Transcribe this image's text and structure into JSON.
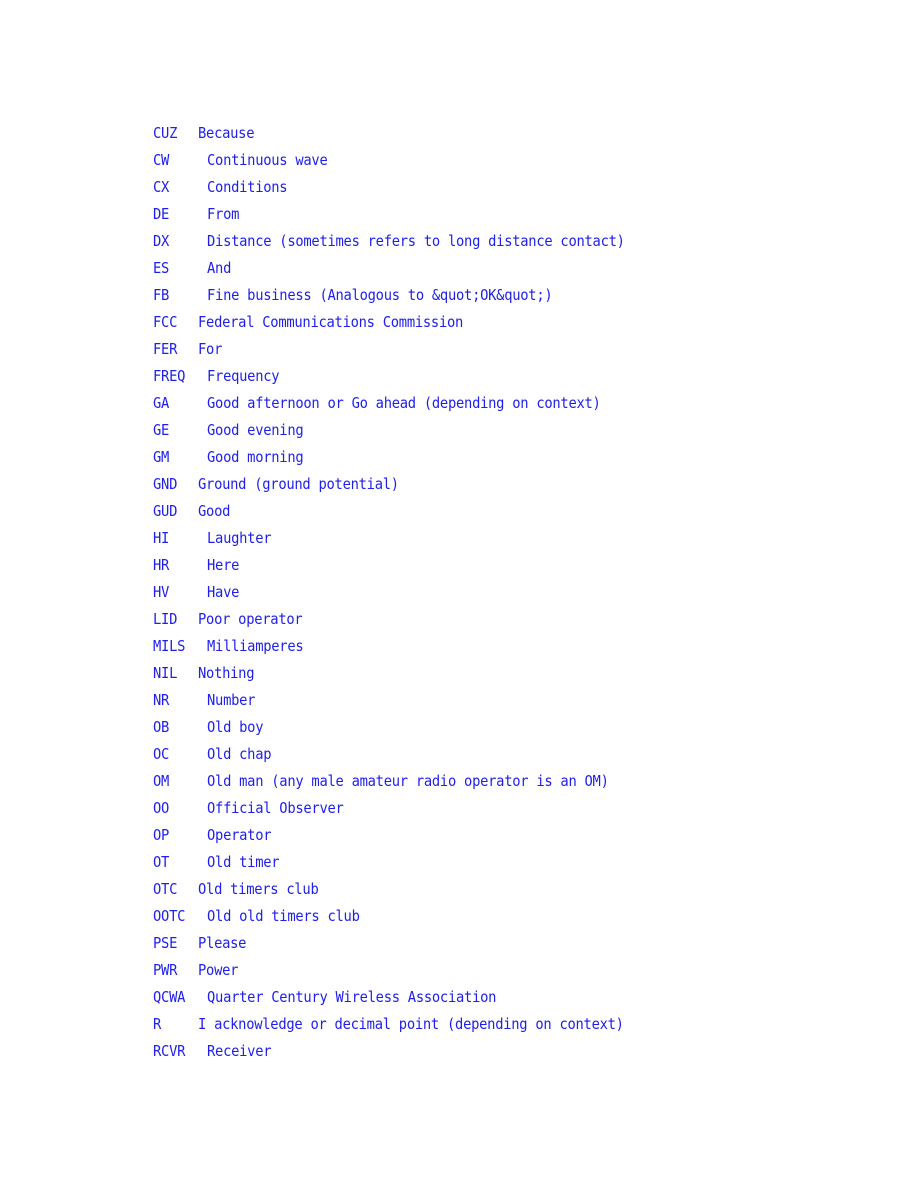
{
  "document": {
    "text_color": "#1e1ef0",
    "entries": [
      {
        "abbr": "CUZ",
        "definition": "Because",
        "indent": "short"
      },
      {
        "abbr": "CW",
        "definition": "Continuous wave",
        "indent": "long"
      },
      {
        "abbr": "CX",
        "definition": "Conditions",
        "indent": "long"
      },
      {
        "abbr": "DE",
        "definition": "From",
        "indent": "long"
      },
      {
        "abbr": "DX",
        "definition": "Distance (sometimes refers to long distance contact)",
        "indent": "long"
      },
      {
        "abbr": "ES",
        "definition": "And",
        "indent": "long"
      },
      {
        "abbr": "FB",
        "definition": "Fine business (Analogous to &quot;OK&quot;)",
        "indent": "long"
      },
      {
        "abbr": "FCC",
        "definition": "Federal Communications Commission",
        "indent": "short"
      },
      {
        "abbr": "FER",
        "definition": "For",
        "indent": "short"
      },
      {
        "abbr": "FREQ",
        "definition": "Frequency",
        "indent": "long"
      },
      {
        "abbr": "GA",
        "definition": "Good afternoon or Go ahead (depending on context)",
        "indent": "long"
      },
      {
        "abbr": "GE",
        "definition": "Good evening",
        "indent": "long"
      },
      {
        "abbr": "GM",
        "definition": "Good morning",
        "indent": "long"
      },
      {
        "abbr": "GND",
        "definition": "Ground (ground potential)",
        "indent": "short"
      },
      {
        "abbr": "GUD",
        "definition": "Good",
        "indent": "short"
      },
      {
        "abbr": "HI",
        "definition": "Laughter",
        "indent": "long"
      },
      {
        "abbr": "HR",
        "definition": "Here",
        "indent": "long"
      },
      {
        "abbr": "HV",
        "definition": "Have",
        "indent": "long"
      },
      {
        "abbr": "LID",
        "definition": "Poor operator",
        "indent": "short"
      },
      {
        "abbr": "MILS",
        "definition": "Milliamperes",
        "indent": "long"
      },
      {
        "abbr": "NIL",
        "definition": "Nothing",
        "indent": "short"
      },
      {
        "abbr": "NR",
        "definition": "Number",
        "indent": "long"
      },
      {
        "abbr": "OB",
        "definition": "Old boy",
        "indent": "long"
      },
      {
        "abbr": "OC",
        "definition": "Old chap",
        "indent": "long"
      },
      {
        "abbr": "OM",
        "definition": "Old man (any male amateur radio operator is an OM)",
        "indent": "long"
      },
      {
        "abbr": "OO",
        "definition": "Official Observer",
        "indent": "long"
      },
      {
        "abbr": "OP",
        "definition": "Operator",
        "indent": "long"
      },
      {
        "abbr": "OT",
        "definition": "Old timer",
        "indent": "long"
      },
      {
        "abbr": "OTC",
        "definition": "Old timers club",
        "indent": "short"
      },
      {
        "abbr": "OOTC",
        "definition": "Old old timers club",
        "indent": "long"
      },
      {
        "abbr": "PSE",
        "definition": "Please",
        "indent": "short"
      },
      {
        "abbr": "PWR",
        "definition": "Power",
        "indent": "short"
      },
      {
        "abbr": "QCWA",
        "definition": "Quarter Century Wireless Association",
        "indent": "long"
      },
      {
        "abbr": "R",
        "definition": "I acknowledge or decimal point (depending on context)",
        "indent": "short"
      },
      {
        "abbr": "RCVR",
        "definition": "Receiver",
        "indent": "long"
      }
    ]
  }
}
